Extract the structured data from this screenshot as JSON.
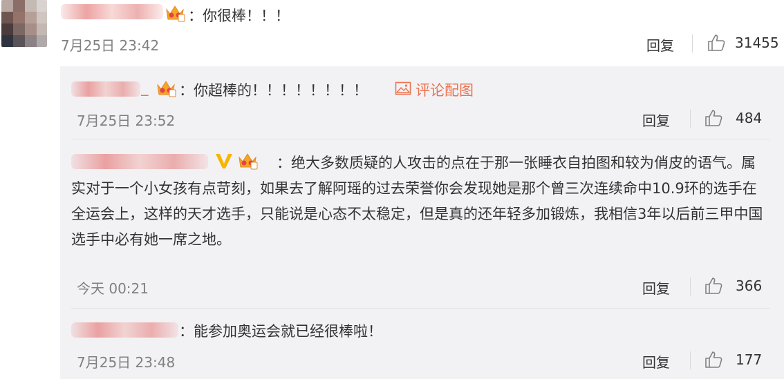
{
  "main_comment": {
    "text": "：你很棒！！！",
    "time": "7月25日 23:42",
    "reply_label": "回复",
    "likes": "31455"
  },
  "replies": [
    {
      "username_tail": "_",
      "text": "：你超棒的！！！！！！！！",
      "pic_link": "评论配图",
      "time": "7月25日 23:52",
      "reply_label": "回复",
      "likes": "484"
    },
    {
      "text": "：绝大多数质疑的人攻击的点在于那一张睡衣自拍图和较为俏皮的语气。属实对于一个小女孩有点苛刻，如果去了解阿瑶的过去荣誉你会发现她是那个曾三次连续命中10.9环的选手在全运会上，这样的天才选手，只能说是心态不太稳定，但是真的还年轻多加锻炼，我相信3年以后前三甲中国选手中必有她一席之地。",
      "time": "今天 00:21",
      "reply_label": "回复",
      "likes": "366"
    },
    {
      "text": "：能参加奥运会就已经很棒啦！",
      "time": "7月25日 23:48",
      "reply_label": "回复",
      "likes": "177"
    }
  ],
  "colors": {
    "accent_link": "#eb7350",
    "meta_gray": "#808080",
    "panel_bg": "#f2f2f5",
    "crown_gold": "#f5a623",
    "verified": "#f7b500"
  },
  "icons": [
    "crown-badge-icon",
    "thumbs-up-icon",
    "image-icon",
    "verified-v-icon"
  ]
}
